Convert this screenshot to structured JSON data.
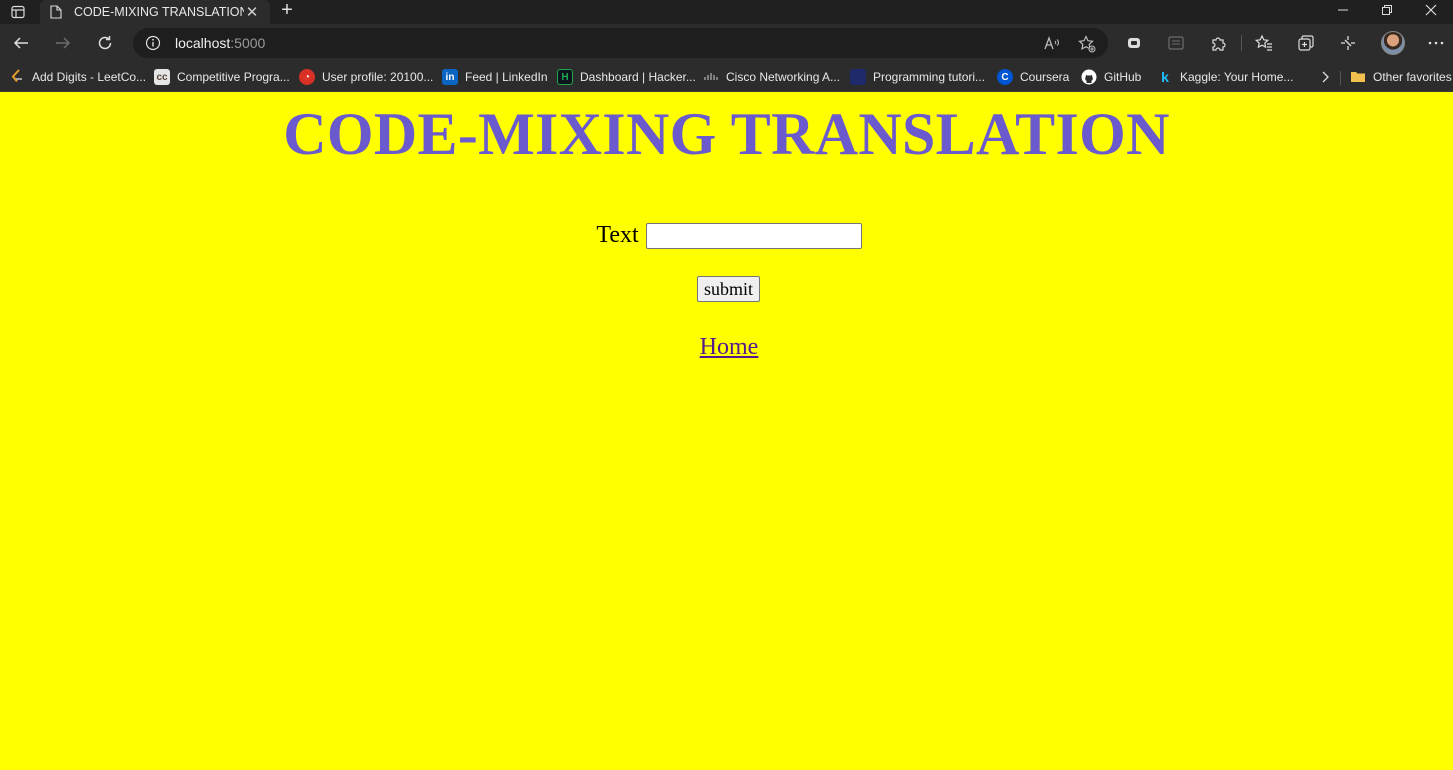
{
  "browser": {
    "tab": {
      "title": "CODE-MIXING TRANSLATION"
    },
    "address": {
      "host": "localhost",
      "port": ":5000"
    },
    "favorites": [
      {
        "label": "Add Digits - LeetCo...",
        "icon": "leetcode-icon",
        "color": "#e79e2b"
      },
      {
        "label": "Competitive Progra...",
        "icon": "codechef-icon",
        "color": "#5b4638"
      },
      {
        "label": "User profile: 20100...",
        "icon": "profile-icon",
        "color": "#d93025"
      },
      {
        "label": "Feed | LinkedIn",
        "icon": "linkedin-icon",
        "color": "#0a66c2"
      },
      {
        "label": "Dashboard | Hacker...",
        "icon": "hackerrank-icon",
        "color": "#1ba94c"
      },
      {
        "label": "Cisco Networking A...",
        "icon": "cisco-icon",
        "color": "#9a9a9a"
      },
      {
        "label": "Programming tutori...",
        "icon": "tutorial-icon",
        "color": "#2b3a8c"
      },
      {
        "label": "Coursera",
        "icon": "coursera-icon",
        "color": "#0056d2"
      },
      {
        "label": "GitHub",
        "icon": "github-icon",
        "color": "#ffffff"
      },
      {
        "label": "Kaggle: Your Home...",
        "icon": "kaggle-icon",
        "color": "#20beff"
      }
    ],
    "other_favorites": "Other favorites"
  },
  "page": {
    "title": "CODE-MIXING TRANSLATION",
    "text_label": "Text",
    "text_value": "",
    "submit_label": "submit",
    "home_link": "Home",
    "colors": {
      "background": "#ffff00",
      "title": "#6a5acd"
    }
  }
}
